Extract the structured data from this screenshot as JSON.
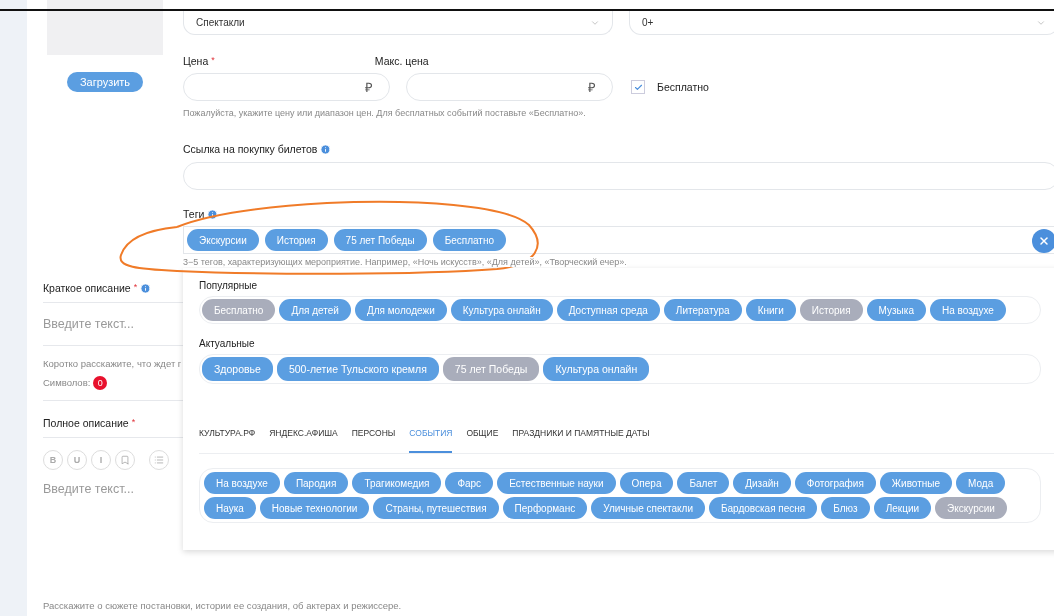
{
  "image_upload": {
    "button": "Загрузить"
  },
  "category_select": {
    "value": "Спектакли"
  },
  "age_select": {
    "value": "0+"
  },
  "price": {
    "label": "Цена",
    "required_mark": "*",
    "currency": "₽"
  },
  "max_price": {
    "label": "Макс. цена",
    "currency": "₽"
  },
  "free_checkbox": {
    "label": "Бесплатно",
    "checked": true
  },
  "price_hint": "Пожалуйста, укажите цену или диапазон цен. Для бесплатных событий поставьте «Бесплатно».",
  "ticket_link": {
    "label": "Ссылка на покупку билетов"
  },
  "tags": {
    "label": "Теги",
    "chips": [
      "Экскурсии",
      "История",
      "75 лет Победы",
      "Бесплатно"
    ],
    "hint": "3−5 тегов, характеризующих мероприятие. Например, «Ночь искусств», «Для детей», «Творческий  ечер»."
  },
  "short_description": {
    "label": "Краткое описание",
    "required_mark": "*",
    "placeholder": "Введите текст...",
    "hint": "Коротко расскажите, что ждет г",
    "counter_label": "Символов:",
    "counter": "0"
  },
  "full_description": {
    "label": "Полное описание",
    "required_mark": "*",
    "tools": [
      "B",
      "U",
      "I"
    ],
    "placeholder": "Введите текст...",
    "hint": "Расскажите о сюжете постановки, истории ее создания, об актерах и режиссере."
  },
  "tag_dropdown": {
    "popular": {
      "title": "Популярные",
      "tags": [
        {
          "label": "Бесплатно",
          "selected": true
        },
        {
          "label": "Для детей",
          "selected": false
        },
        {
          "label": "Для молодежи",
          "selected": false
        },
        {
          "label": "Культура онлайн",
          "selected": false
        },
        {
          "label": "Доступная среда",
          "selected": false
        },
        {
          "label": "Литература",
          "selected": false
        },
        {
          "label": "Книги",
          "selected": false
        },
        {
          "label": "История",
          "selected": true
        },
        {
          "label": "Музыка",
          "selected": false
        },
        {
          "label": "На воздухе",
          "selected": false
        }
      ]
    },
    "current": {
      "title": "Актуальные",
      "tags": [
        {
          "label": "Здоровье",
          "selected": false
        },
        {
          "label": "500-летие Тульского кремля",
          "selected": false
        },
        {
          "label": "75 лет Победы",
          "selected": true
        },
        {
          "label": "Культура онлайн",
          "selected": false
        }
      ]
    },
    "tabs": [
      {
        "label": "КУЛЬТУРА.РФ",
        "selected": false
      },
      {
        "label": "ЯНДЕКС.АФИША",
        "selected": false
      },
      {
        "label": "ПЕРСОНЫ",
        "selected": false
      },
      {
        "label": "СОБЫТИЯ",
        "selected": true
      },
      {
        "label": "ОБЩИЕ",
        "selected": false
      },
      {
        "label": "ПРАЗДНИКИ И ПАМЯТНЫЕ ДАТЫ",
        "selected": false
      }
    ],
    "tab_tags": [
      {
        "label": "На воздухе",
        "selected": false
      },
      {
        "label": "Пародия",
        "selected": false
      },
      {
        "label": "Трагикомедия",
        "selected": false
      },
      {
        "label": "Фарс",
        "selected": false
      },
      {
        "label": "Естественные науки",
        "selected": false
      },
      {
        "label": "Опера",
        "selected": false
      },
      {
        "label": "Балет",
        "selected": false
      },
      {
        "label": "Дизайн",
        "selected": false
      },
      {
        "label": "Фотография",
        "selected": false
      },
      {
        "label": "Животные",
        "selected": false
      },
      {
        "label": "Мода",
        "selected": false
      },
      {
        "label": "Наука",
        "selected": false
      },
      {
        "label": "Новые технологии",
        "selected": false
      },
      {
        "label": "Страны, путешествия",
        "selected": false
      },
      {
        "label": "Перформанс",
        "selected": false
      },
      {
        "label": "Уличные спектакли",
        "selected": false
      },
      {
        "label": "Бардовская песня",
        "selected": false
      },
      {
        "label": "Блюз",
        "selected": false
      },
      {
        "label": "Лекции",
        "selected": false
      },
      {
        "label": "Экскурсии",
        "selected": true
      }
    ]
  }
}
